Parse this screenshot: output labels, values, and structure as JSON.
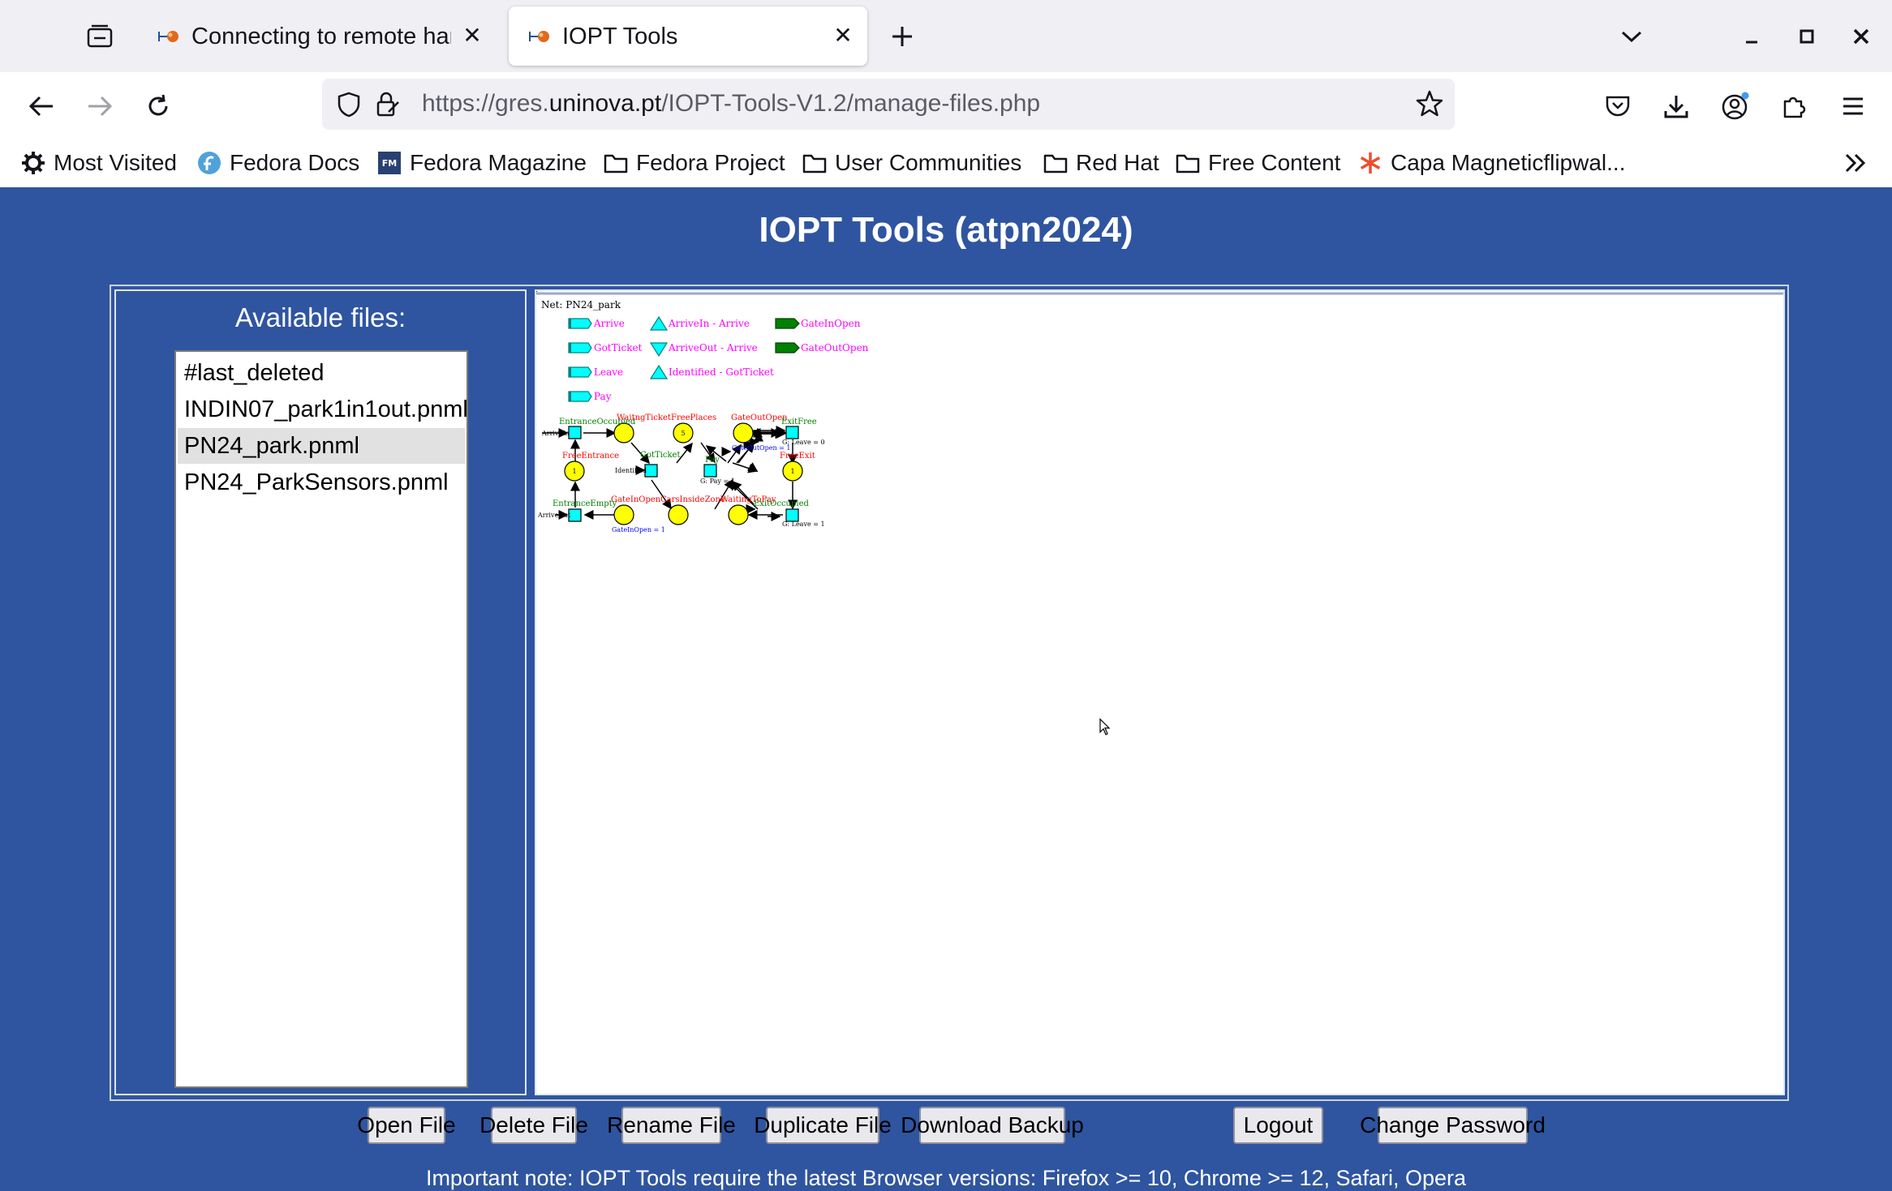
{
  "browser": {
    "tabs": [
      {
        "title": "Connecting to remote hardware",
        "active": false
      },
      {
        "title": "IOPT Tools",
        "active": true
      }
    ],
    "url": {
      "prefix": "https://gres.",
      "host": "uninova.pt",
      "path": "/IOPT-Tools-V1.2/manage-files.php"
    },
    "bookmarks": [
      {
        "label": "Most Visited",
        "icon": "gear-icon"
      },
      {
        "label": "Fedora Docs",
        "icon": "fedora-icon"
      },
      {
        "label": "Fedora Magazine",
        "icon": "fm-icon"
      },
      {
        "label": "Fedora Project",
        "icon": "folder-icon"
      },
      {
        "label": "User Communities",
        "icon": "folder-icon"
      },
      {
        "label": "Red Hat",
        "icon": "folder-icon"
      },
      {
        "label": "Free Content",
        "icon": "folder-icon"
      },
      {
        "label": "Capa Magneticflipwal...",
        "icon": "asterisk-icon"
      }
    ]
  },
  "page": {
    "title": "IOPT Tools (atpn2024)",
    "files_heading": "Available files:",
    "files": [
      "#last_deleted",
      "INDIN07_park1in1out.pnml",
      "PN24_park.pnml",
      "PN24_ParkSensors.pnml"
    ],
    "selected_file": "PN24_park.pnml",
    "buttons": {
      "open": "Open File",
      "delete": "Delete File",
      "rename": "Rename File",
      "duplicate": "Duplicate File",
      "backup": "Download Backup",
      "logout": "Logout",
      "change_password": "Change Password"
    },
    "note": "Important note: IOPT Tools require the latest Browser versions: Firefox >= 10, Chrome >= 12, Safari, Opera"
  },
  "net": {
    "name": "Net: PN24_park",
    "inputs": [
      "Arrive",
      "GotTicket",
      "Leave",
      "Pay"
    ],
    "events_in": [
      "ArriveIn - Arrive",
      "Identified - GotTicket"
    ],
    "events_out": [
      "ArriveOut - Arrive"
    ],
    "outputs": [
      "GateInOpen",
      "GateOutOpen"
    ],
    "places": [
      {
        "name": "WaitngTicket",
        "tokens": ""
      },
      {
        "name": "FreePlaces",
        "tokens": "5"
      },
      {
        "name": "GateOutOpen",
        "tokens": ""
      },
      {
        "name": "FreeEntrance",
        "tokens": "1"
      },
      {
        "name": "FreeExit",
        "tokens": "1"
      },
      {
        "name": "GateInOpen",
        "tokens": ""
      },
      {
        "name": "CarsInsideZone",
        "tokens": ""
      },
      {
        "name": "WaitingToPay",
        "tokens": ""
      }
    ],
    "transitions": [
      "EntranceOccupied",
      "GotTicket",
      "Pay",
      "ExitFree",
      "EntranceEmpty",
      "ExitOccupied"
    ],
    "transition_events": [
      "ArriveIn",
      "Identified",
      "ArriveOut"
    ],
    "guards": [
      "G: Leave = 0",
      "G: Pay = 1",
      "G: Leave = 1"
    ],
    "actions": [
      "GateOutOpen = 1",
      "GateInOpen = 1"
    ]
  },
  "colors": {
    "page_bg": "#2f55a0",
    "place_fill": "#ffff00",
    "transition_fill": "#00ffff",
    "place_label": "#ff0000",
    "transition_label": "#008000",
    "signal_label": "#ff00ff",
    "action_label": "#0000ff"
  }
}
